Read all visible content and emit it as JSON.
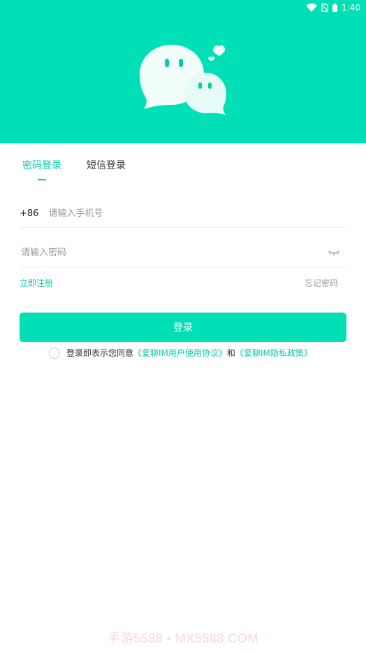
{
  "status_bar": {
    "time": "1:40",
    "icons": [
      "wifi-icon",
      "no-sim-icon",
      "battery-icon"
    ]
  },
  "header": {
    "background_color": "#00dfb6",
    "mascot": "chat-bubbles-mascot-icon"
  },
  "tabs": [
    {
      "label": "密码登录",
      "active": true
    },
    {
      "label": "短信登录",
      "active": false
    }
  ],
  "phone_field": {
    "prefix": "+86",
    "placeholder": "请输入手机号",
    "value": ""
  },
  "password_field": {
    "placeholder": "请输入密码",
    "value": "",
    "toggle_icon": "eye-closed-icon"
  },
  "links": {
    "register": "立即注册",
    "forgot": "忘记密码"
  },
  "login_button": {
    "label": "登录"
  },
  "agreement": {
    "prefix": "登录即表示您同意",
    "user_agreement": "《爱聊IM用户使用协议》",
    "connector": "和",
    "privacy_policy": "《爱聊IM隐私政策》"
  },
  "watermark": "手游5588 • MX5588.COM",
  "colors": {
    "accent": "#00dfb6",
    "accent_text": "#00cfa9",
    "placeholder": "#999999"
  }
}
